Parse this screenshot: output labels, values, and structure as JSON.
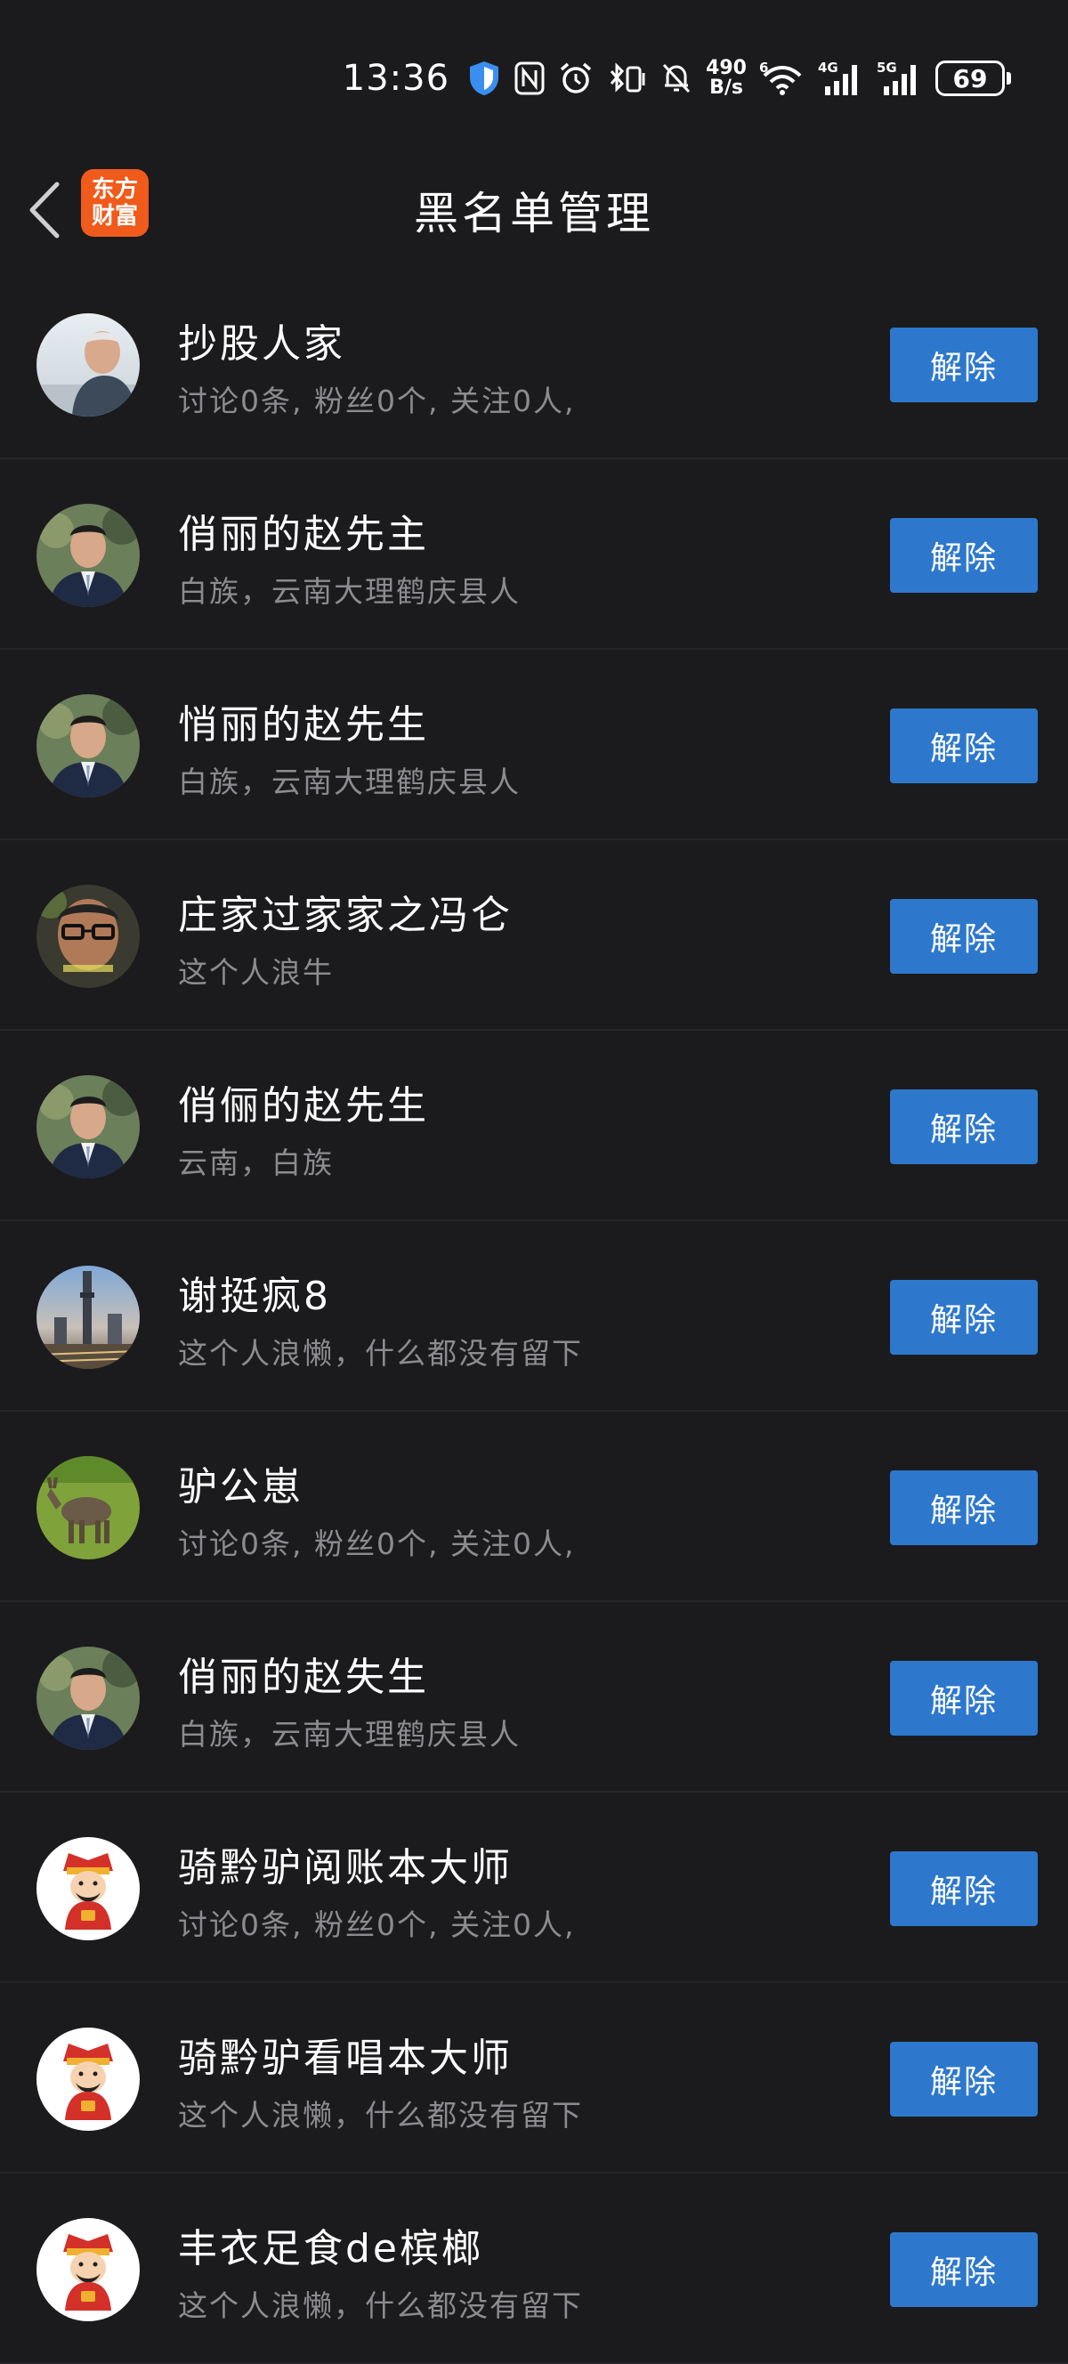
{
  "status_bar": {
    "time": "13:36",
    "net_speed_value": "490",
    "net_speed_unit": "B/s",
    "wifi_label": "6",
    "sim1_label": "4G",
    "sim2_label": "5G",
    "battery": "69"
  },
  "header": {
    "title": "黑名单管理",
    "logo_line1": "东方",
    "logo_line2": "财富"
  },
  "list": {
    "items": [
      {
        "name": "抄股人家",
        "bio": "讨论0条, 粉丝0个, 关注0人,",
        "button": "解除",
        "avatar": "photo-old-man"
      },
      {
        "name": "俏丽的赵先主",
        "bio": "白族，云南大理鹤庆县人",
        "button": "解除",
        "avatar": "photo-man-suit"
      },
      {
        "name": "悄丽的赵先生",
        "bio": "白族，云南大理鹤庆县人",
        "button": "解除",
        "avatar": "photo-man-suit"
      },
      {
        "name": "庄家过家家之冯仑",
        "bio": "这个人浪牛",
        "button": "解除",
        "avatar": "photo-man-glasses"
      },
      {
        "name": "俏俪的赵先生",
        "bio": "云南，白族",
        "button": "解除",
        "avatar": "photo-man-suit"
      },
      {
        "name": "谢挺疯8",
        "bio": "这个人浪懒，什么都没有留下",
        "button": "解除",
        "avatar": "photo-city-tower"
      },
      {
        "name": "驴公崽",
        "bio": "讨论0条, 粉丝0个, 关注0人,",
        "button": "解除",
        "avatar": "photo-donkey"
      },
      {
        "name": "俏丽的赵失生",
        "bio": "白族，云南大理鹤庆县人",
        "button": "解除",
        "avatar": "photo-man-suit"
      },
      {
        "name": "骑黔驴阅账本大师",
        "bio": "讨论0条, 粉丝0个, 关注0人,",
        "button": "解除",
        "avatar": "cartoon-fortune-god"
      },
      {
        "name": "骑黔驴看唱本大师",
        "bio": "这个人浪懒，什么都没有留下",
        "button": "解除",
        "avatar": "cartoon-fortune-god"
      },
      {
        "name": "丰衣足食de槟榔",
        "bio": "这个人浪懒，什么都没有留下",
        "button": "解除",
        "avatar": "cartoon-fortune-god"
      }
    ]
  },
  "colors": {
    "background": "#1b1b1d",
    "button": "#2d78cc",
    "bio_text": "#8c8c90",
    "logo": "#f05a1a"
  }
}
